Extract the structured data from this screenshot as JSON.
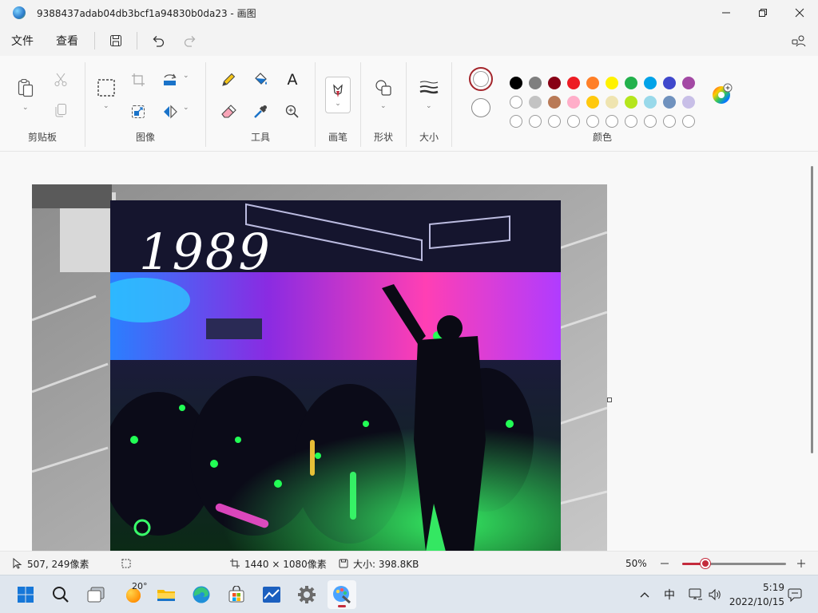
{
  "window": {
    "title": "9388437adab04db3bcf1a94830b0da23 - 画图"
  },
  "menu": {
    "file": "文件",
    "view": "查看"
  },
  "ribbon": {
    "groups": {
      "clipboard": "剪贴板",
      "image": "图像",
      "tools": "工具",
      "brushes": "画笔",
      "shapes": "形状",
      "size": "大小",
      "colors": "颜色"
    },
    "text_tool_glyph": "A"
  },
  "palette": {
    "row1": [
      "#000000",
      "#7f7f7f",
      "#880015",
      "#ed1c24",
      "#ff7f27",
      "#fff200",
      "#22b14c",
      "#00a2e8",
      "#3f48cc",
      "#a349a4"
    ],
    "row2": [
      "#ffffff",
      "#c3c3c3",
      "#b97a57",
      "#ffaec9",
      "#ffc90e",
      "#efe4b0",
      "#b5e61d",
      "#99d9ea",
      "#7092be",
      "#c8bfe7"
    ],
    "row3_empty_count": 10,
    "color1": "#ffffff",
    "color1_ring": "#a4262c",
    "color2": "#ffffff",
    "accent": "#c42b3c"
  },
  "canvas": {
    "overlay_text": "1989"
  },
  "status": {
    "cursor_pos": "507, 249像素",
    "canvas_size": "1440 × 1080像素",
    "file_size": "大小: 398.8KB",
    "zoom": "50%",
    "zoom_level": 0.22
  },
  "taskbar": {
    "weather_temp": "20°",
    "ime": "中",
    "time": "5:19",
    "date": "2022/10/15"
  }
}
